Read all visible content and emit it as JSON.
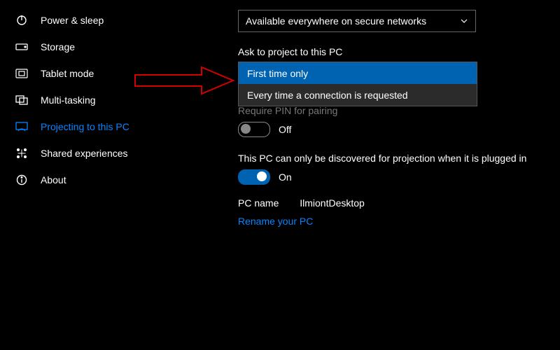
{
  "sidebar": {
    "items": [
      {
        "label": "Power & sleep"
      },
      {
        "label": "Storage"
      },
      {
        "label": "Tablet mode"
      },
      {
        "label": "Multi-tasking"
      },
      {
        "label": "Projecting to this PC"
      },
      {
        "label": "Shared experiences"
      },
      {
        "label": "About"
      }
    ]
  },
  "main": {
    "availability_select": "Available everywhere on secure networks",
    "ask_label": "Ask to project to this PC",
    "ask_options": [
      "First time only",
      "Every time a connection is requested"
    ],
    "pin_label_obscured": "Require PIN for pairing",
    "pin_state": "Off",
    "discover_label": "This PC can only be discovered for projection when it is plugged in",
    "discover_state": "On",
    "pcname_label": "PC name",
    "pcname_value": "IlmiontDesktop",
    "rename_link": "Rename your PC"
  }
}
